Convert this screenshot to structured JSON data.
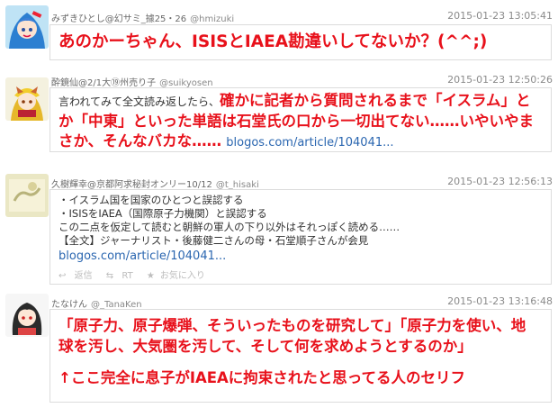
{
  "tweets": [
    {
      "name": "みずきひとし@幻サミ_據25・26",
      "handle": "@hmizuki",
      "time": "2015-01-23 13:05:41",
      "text_red": "あのかーちゃん、ISISとIAEA勘違いしてないか？(^^;)"
    },
    {
      "name": "酔鏡仙@2/1大⑲州売り子",
      "handle": "@suikyosen",
      "time": "2015-01-23 12:50:26",
      "text_plain": "言われてみて全文読み返したら、",
      "text_red_1": "確かに記者から質問されるまで「イスラム」と",
      "text_red_2": "か「中東」といった単語は石堂氏の口から一切出てない……いやいやま",
      "text_red_3": "さか、そんなバカな……",
      "link": "blogos.com/article/104041..."
    },
    {
      "name": "久樹輝幸@京都阿求秘封オンリー10/12",
      "handle": "@t_hisaki",
      "time": "2015-01-23 12:56:13",
      "lines": [
        "・イスラム国を国家のひとつと誤認する",
        "・ISISをIAEA（国際原子力機関）と誤認する",
        "この二点を仮定して読むと朝鮮の軍人の下り以外はそれっぽく読める……",
        "【全文】ジャーナリスト・後藤健二さんの母・石堂順子さんが会見"
      ],
      "link": "blogos.com/article/104041...",
      "actions": {
        "reply": "返信",
        "retweet": "RT",
        "favorite": "お気に入り"
      }
    },
    {
      "name": "たなけん",
      "handle": "@_TanaKen",
      "time": "2015-01-23 13:16:48",
      "quote_1": "「原子力、原子爆弾、そういったものを研究して」「原子力を使い、地",
      "quote_2": "球を汚し、大気圏を汚して、そして何を求めようとするのか」",
      "comment": "↑ここ完全に息子がIAEAに拘束されたと思ってる人のセリフ"
    }
  ]
}
